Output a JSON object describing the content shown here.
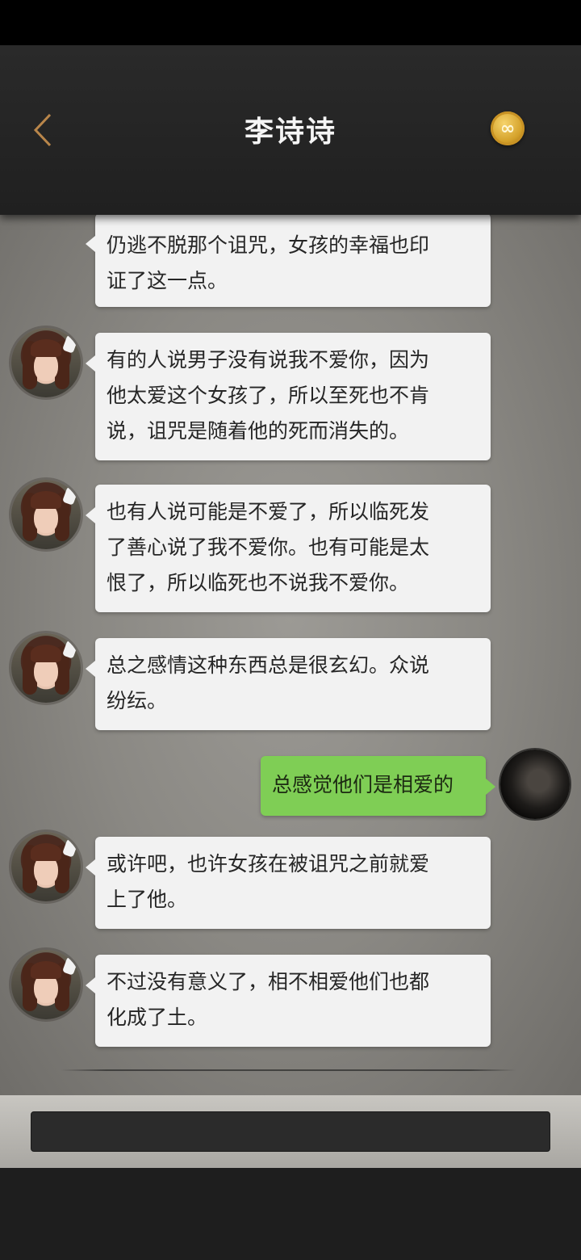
{
  "header": {
    "title": "李诗诗",
    "badge_symbol": "∞"
  },
  "messages": [
    {
      "from": "contact",
      "text": "仍逃不脱那个诅咒，女孩的幸福也印\n证了这一点。"
    },
    {
      "from": "contact",
      "text": "有的人说男子没有说我不爱你，因为\n他太爱这个女孩了，所以至死也不肯\n说，诅咒是随着他的死而消失的。"
    },
    {
      "from": "contact",
      "text": "也有人说可能是不爱了，所以临死发\n了善心说了我不爱你。也有可能是太\n恨了，所以临死也不说我不爱你。"
    },
    {
      "from": "contact",
      "text": "总之感情这种东西总是很玄幻。众说\n纷纭。"
    },
    {
      "from": "user",
      "text": "总感觉他们是相爱的"
    },
    {
      "from": "contact",
      "text": "或许吧，也许女孩在被诅咒之前就爱\n上了他。"
    },
    {
      "from": "contact",
      "text": "不过没有意义了，相不相爱他们也都\n化成了土。"
    }
  ],
  "input": {
    "value": "",
    "placeholder": ""
  },
  "colors": {
    "user_bubble": "#7fce55",
    "contact_bubble": "#f2f2f2",
    "header_bg": "#242424",
    "badge_gold": "#d4a12a"
  }
}
